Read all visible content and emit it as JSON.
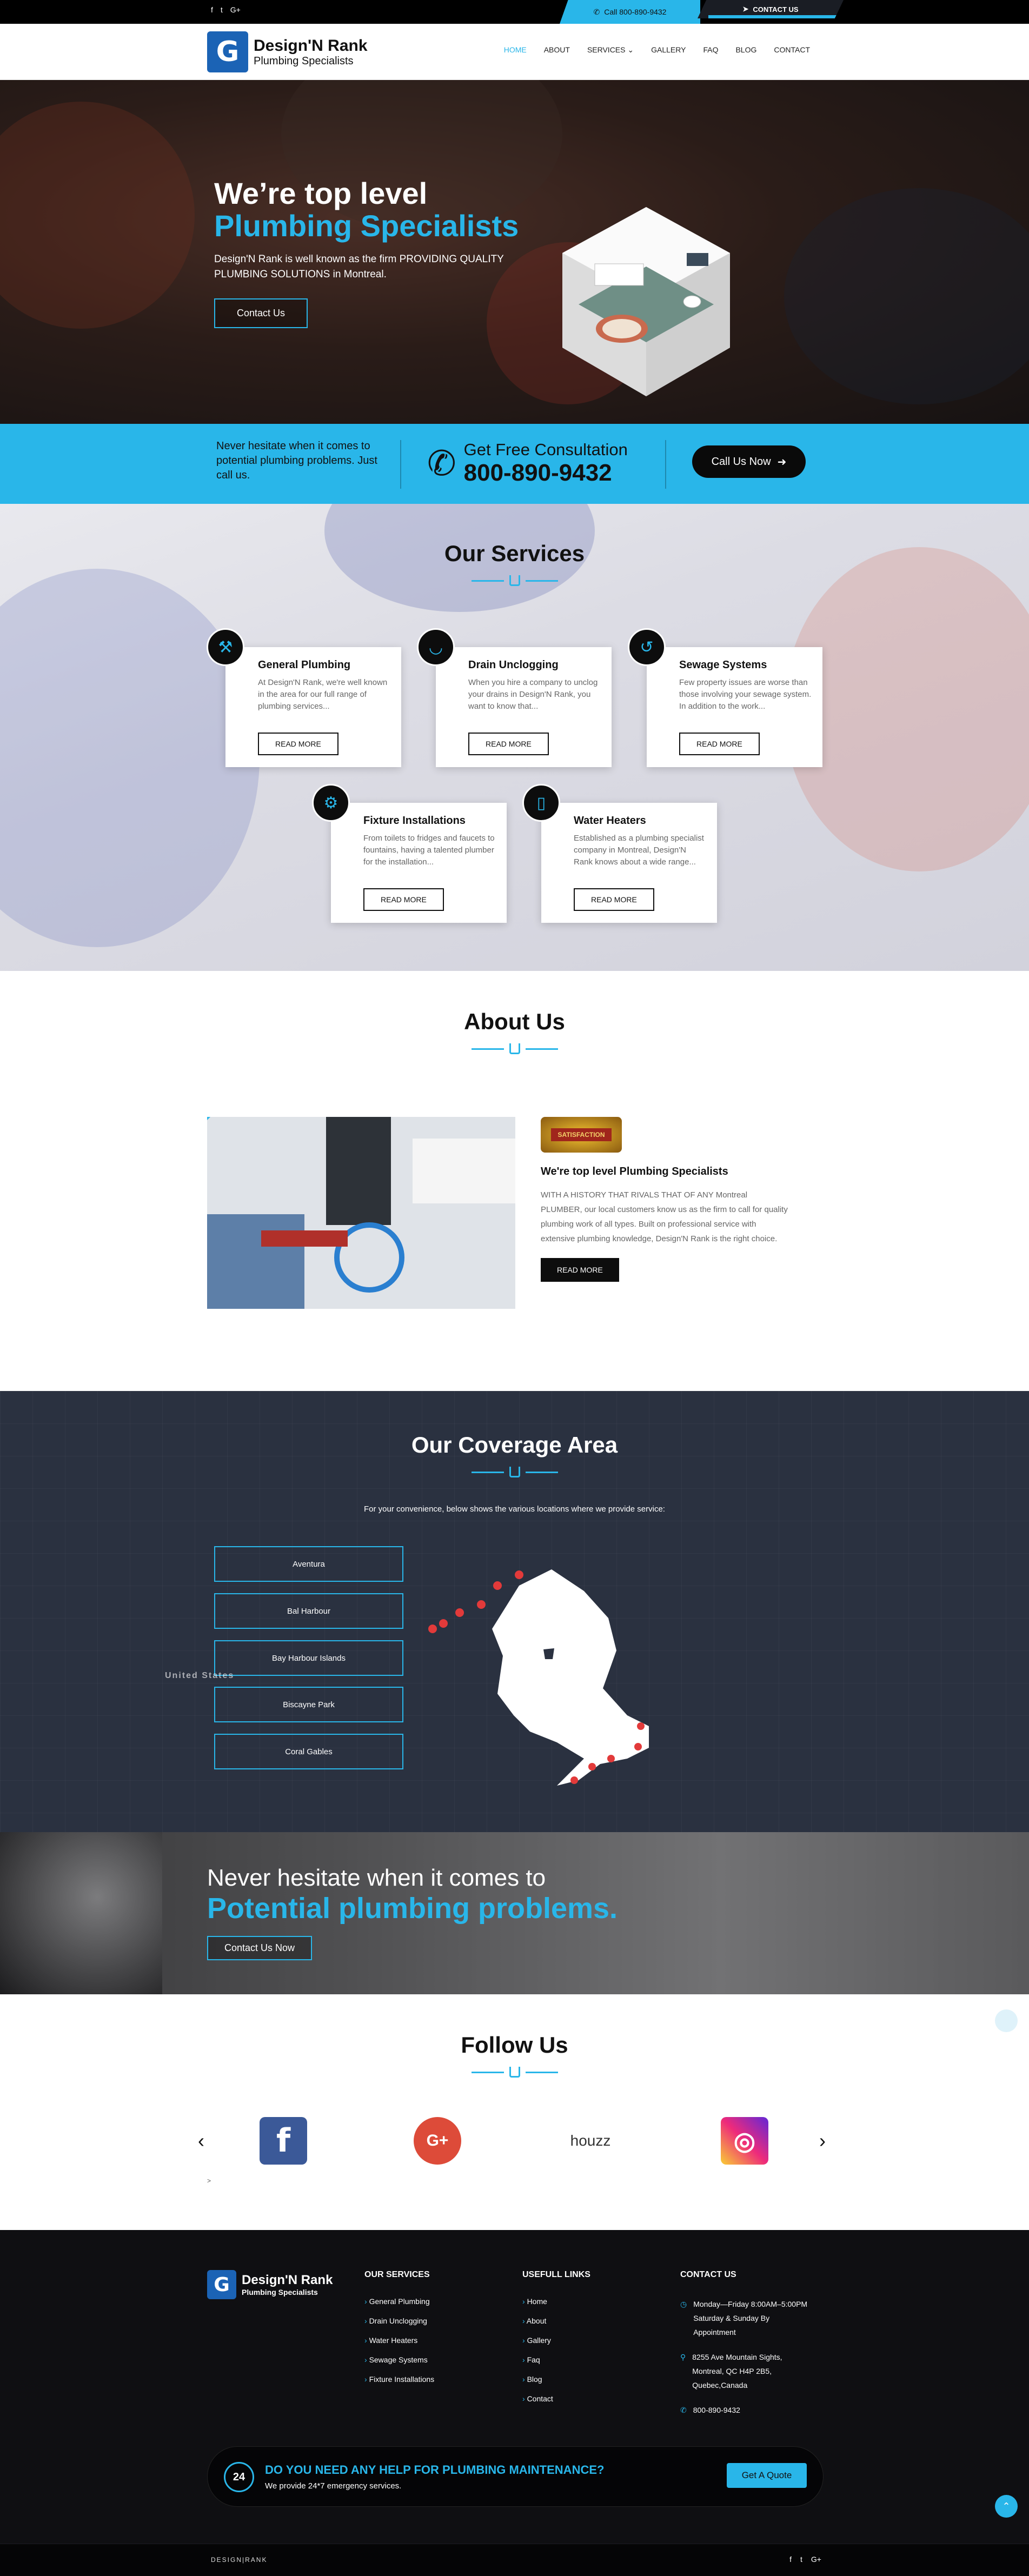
{
  "topbar": {
    "social_icons": [
      "f",
      "t",
      "G+"
    ],
    "phone": "Call 800-890-9432",
    "contact": "CONTACT US"
  },
  "header": {
    "logo_mark": "G",
    "logo_title": "Design'N Rank",
    "logo_subtitle": "Plumbing Specialists",
    "nav": [
      "HOME",
      "ABOUT",
      "SERVICES",
      "GALLERY",
      "FAQ",
      "BLOG",
      "CONTACT"
    ],
    "services_caret": "⌄"
  },
  "hero": {
    "line1": "We’re top level",
    "line2": "Plumbing Specialists",
    "desc": "Design'N Rank is well known as the firm PROVIDING QUALITY PLUMBING SOLUTIONS in Montreal.",
    "button": "Contact Us"
  },
  "cta": {
    "left_text": "Never hesitate when it comes to potential plumbing problems. Just call us.",
    "consult_label": "Get Free Consultation",
    "phone": "800-890-9432",
    "button": "Call Us Now",
    "button_arrow": "➜",
    "phone_icon": "✆"
  },
  "services": {
    "title": "Our Services",
    "cards": [
      {
        "title": "General Plumbing",
        "text": "At Design'N Rank, we're well known in the area for our full range of plumbing services...",
        "button": "READ MORE",
        "icon": "⚒"
      },
      {
        "title": "Drain Unclogging",
        "text": "When you hire a company to unclog your drains in Design'N Rank, you want to know that...",
        "button": "READ MORE",
        "icon": "◡"
      },
      {
        "title": "Sewage Systems",
        "text": "Few property issues are worse than those involving your sewage system. In addition to the work...",
        "button": "READ MORE",
        "icon": "↺"
      },
      {
        "title": "Fixture Installations",
        "text": "From toilets to fridges and faucets to fountains, having a talented plumber for the installation...",
        "button": "READ MORE",
        "icon": "⚙"
      },
      {
        "title": "Water Heaters",
        "text": "Established as a plumbing specialist company in Montreal, Design'N Rank knows about a wide range...",
        "button": "READ MORE",
        "icon": "▯"
      }
    ]
  },
  "about": {
    "title": "About Us",
    "seal": "SATISFACTION",
    "heading": "We're top level Plumbing Specialists",
    "text": "WITH A HISTORY THAT RIVALS THAT OF ANY Montreal PLUMBER, our local customers know us as the firm to call for quality plumbing work of all types. Built on professional service with extensive plumbing knowledge, Design'N Rank is the right choice.",
    "button": "READ MORE"
  },
  "coverage": {
    "title": "Our Coverage Area",
    "intro": "For your convenience, below shows the various locations where we provide service:",
    "locations": [
      "Aventura",
      "Bal Harbour",
      "Bay Harbour Islands",
      "Biscayne Park",
      "Coral Gables"
    ],
    "map_label": "United States"
  },
  "banner": {
    "line1": "Never hesitate when it comes to",
    "line2": "Potential plumbing problems.",
    "button": "Contact Us Now"
  },
  "follow": {
    "title": "Follow Us",
    "logos": [
      "f",
      "G+",
      "houzz",
      "◎"
    ],
    "prev": "‹",
    "next": "›",
    "small_arrow": ">"
  },
  "footer": {
    "logo_mark": "G",
    "logo_title": "Design'N Rank",
    "logo_subtitle": "Plumbing Specialists",
    "services_heading": "OUR SERVICES",
    "services": [
      "General Plumbing",
      "Drain Unclogging",
      "Water Heaters",
      "Sewage Systems",
      "Fixture Installations"
    ],
    "links_heading": "USEFULL LINKS",
    "links": [
      "Home",
      "About",
      "Gallery",
      "Faq",
      "Blog",
      "Contact"
    ],
    "contact_heading": "CONTACT US",
    "hours": "Monday—Friday 8:00AM–5:00PM Saturday & Sunday By Appointment",
    "address": "8255 Ave Mountain Sights, Montreal, QC H4P 2B5, Quebec,Canada",
    "phone": "800-890-9432",
    "help_title": "DO YOU NEED ANY HELP FOR PLUMBING MAINTENANCE?",
    "help_sub": "We provide 24*7 emergency services.",
    "help_clock": "24",
    "help_button": "Get A Quote",
    "copyright_brand": "DESIGN|RANK",
    "copyright_social": [
      "f",
      "t",
      "G+"
    ],
    "to_top": "⌃"
  },
  "colors": {
    "accent": "#29b6e9",
    "dark": "#0f0f12",
    "facebook": "#3b5998",
    "google": "#dd4b39",
    "houzz": "#7ac142",
    "instagram": "#c13584"
  }
}
